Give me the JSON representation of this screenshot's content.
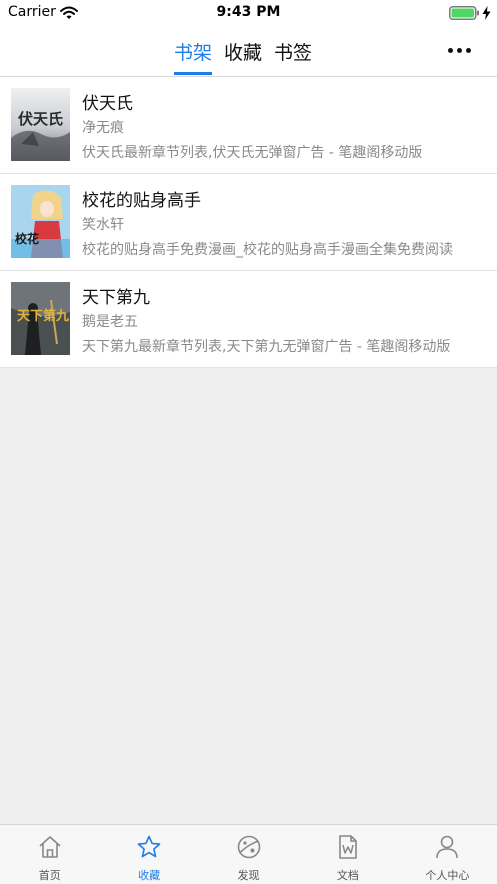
{
  "status_bar": {
    "carrier": "Carrier",
    "time": "9:43 PM",
    "icons": [
      "wifi-icon",
      "battery-icon",
      "charging-icon"
    ]
  },
  "header": {
    "tabs": [
      {
        "label": "书架",
        "active": true
      },
      {
        "label": "收藏",
        "active": false
      },
      {
        "label": "书签",
        "active": false
      }
    ],
    "more_icon": "ellipsis-icon"
  },
  "books": [
    {
      "title": "伏天氏",
      "author": "净无痕",
      "description": "伏天氏最新章节列表,伏天氏无弹窗广告 - 笔趣阁移动版",
      "cover_text": "伏天氏"
    },
    {
      "title": "校花的贴身高手",
      "author": "笑水轩",
      "description": "校花的贴身高手免费漫画_校花的贴身高手漫画全集免费阅读",
      "cover_text": "校花"
    },
    {
      "title": "天下第九",
      "author": "鹅是老五",
      "description": "天下第九最新章节列表,天下第九无弹窗广告 - 笔趣阁移动版",
      "cover_text": "天下第九"
    }
  ],
  "tabbar": {
    "items": [
      {
        "label": "首页",
        "icon": "home-icon",
        "active": false
      },
      {
        "label": "收藏",
        "icon": "star-icon",
        "active": true
      },
      {
        "label": "发现",
        "icon": "planet-icon",
        "active": false
      },
      {
        "label": "文档",
        "icon": "document-icon",
        "active": false
      },
      {
        "label": "个人中心",
        "icon": "person-icon",
        "active": false
      }
    ]
  },
  "colors": {
    "accent": "#1e7ee8",
    "background": "#efeff0",
    "secondary_text": "#8a8a8a"
  }
}
